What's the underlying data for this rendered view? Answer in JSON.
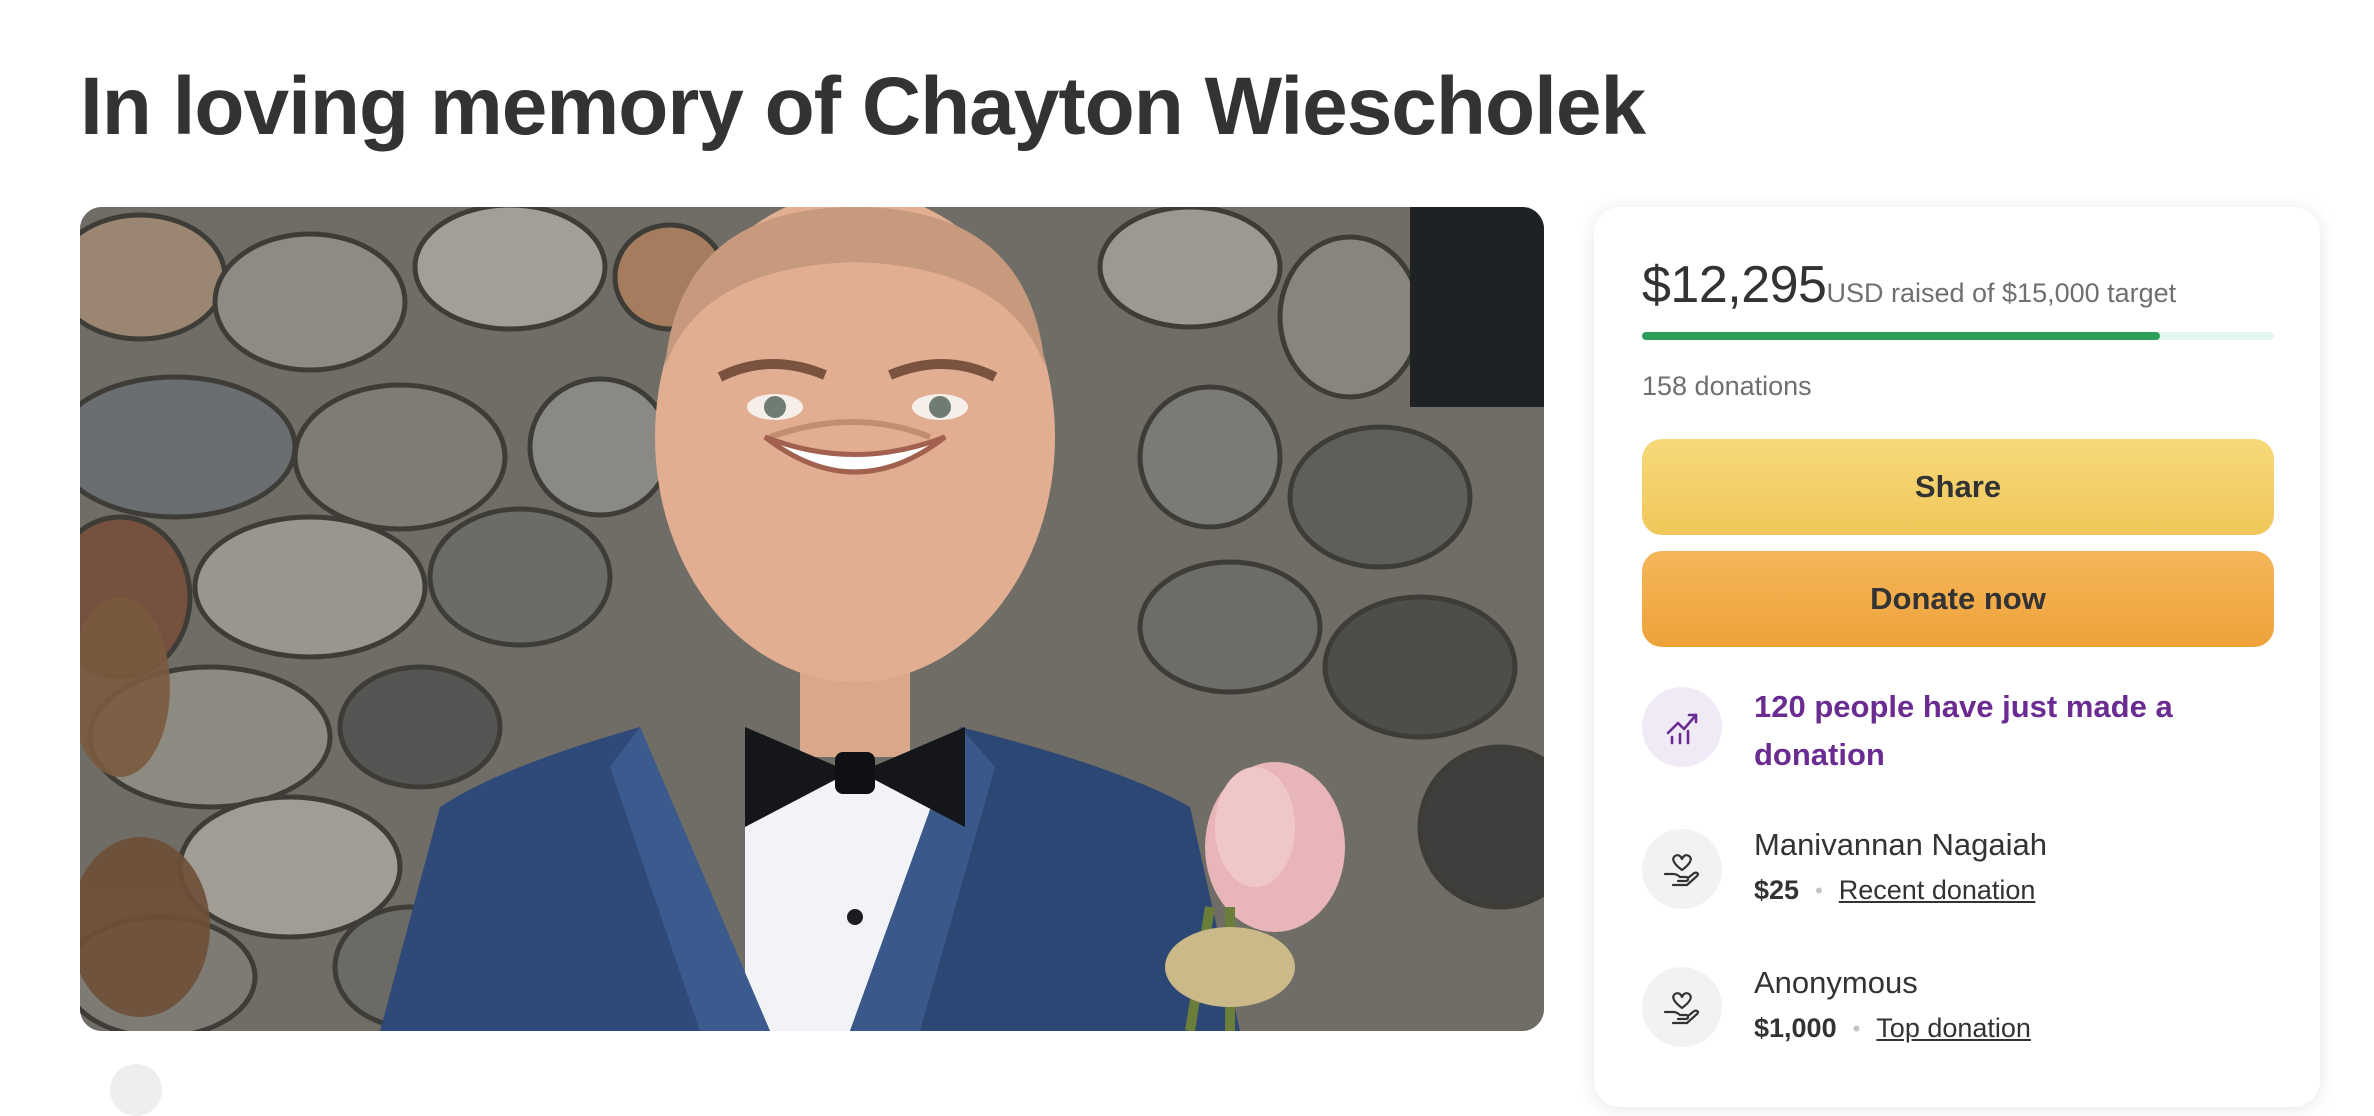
{
  "page": {
    "title": "In loving memory of Chayton Wiescholek"
  },
  "fundraiser": {
    "amount_raised": "$12,295",
    "currency": "USD",
    "raised_suffix": " raised of $15,000 target",
    "progress_fraction": 0.8197,
    "donation_count": "158 donations",
    "share_label": "Share",
    "donate_label": "Donate now"
  },
  "activity": {
    "trend_text": "120 people have just made a donation",
    "donors": [
      {
        "name": "Manivannan Nagaiah",
        "amount": "$25",
        "label": "Recent donation"
      },
      {
        "name": "Anonymous",
        "amount": "$1,000",
        "label": "Top donation"
      }
    ]
  },
  "colors": {
    "progress": "#2f9e5a",
    "share_button": "#f0c75a",
    "donate_button": "#eea23a",
    "trend_text": "#6a2c91"
  },
  "icons": {
    "trend": "trending-up-icon",
    "donor": "heart-hand-icon"
  }
}
